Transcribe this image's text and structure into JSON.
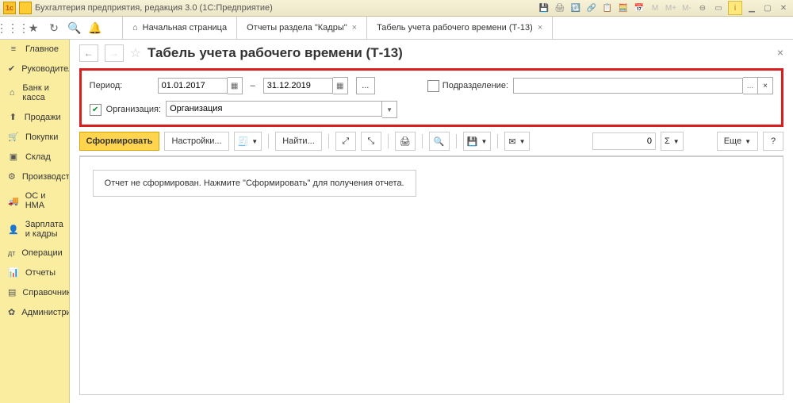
{
  "titlebar": {
    "logo_text": "1с",
    "title": "Бухгалтерия предприятия, редакция 3.0  (1С:Предприятие)"
  },
  "tabs": {
    "home": "Начальная страница",
    "t1": "Отчеты раздела \"Кадры\"",
    "t2": "Табель учета рабочего времени (Т-13)"
  },
  "sidebar": [
    {
      "icon": "≡",
      "label": "Главное"
    },
    {
      "icon": "✔",
      "label": "Руководителю"
    },
    {
      "icon": "⌂",
      "label": "Банк и касса"
    },
    {
      "icon": "⬆",
      "label": "Продажи"
    },
    {
      "icon": "🛒",
      "label": "Покупки"
    },
    {
      "icon": "▣",
      "label": "Склад"
    },
    {
      "icon": "⚙",
      "label": "Производство"
    },
    {
      "icon": "🚚",
      "label": "ОС и НМА"
    },
    {
      "icon": "👤",
      "label": "Зарплата и кадры"
    },
    {
      "icon": "дт",
      "label": "Операции"
    },
    {
      "icon": "📊",
      "label": "Отчеты"
    },
    {
      "icon": "▤",
      "label": "Справочники"
    },
    {
      "icon": "✿",
      "label": "Администрирование"
    }
  ],
  "page": {
    "title": "Табель учета рабочего времени (Т-13)"
  },
  "filters": {
    "period_label": "Период:",
    "date_from": "01.01.2017",
    "date_sep": "–",
    "date_to": "31.12.2019",
    "dots": "...",
    "subdiv_label": "Подразделение:",
    "org_label": "Организация:",
    "org_value": "Организация",
    "clear": "×"
  },
  "toolbar": {
    "form": "Сформировать",
    "settings": "Настройки...",
    "find": "Найти...",
    "more": "Еще",
    "help": "?",
    "zero": "0",
    "sigma": "Σ"
  },
  "report": {
    "message": "Отчет не сформирован. Нажмите \"Сформировать\" для получения отчета."
  }
}
